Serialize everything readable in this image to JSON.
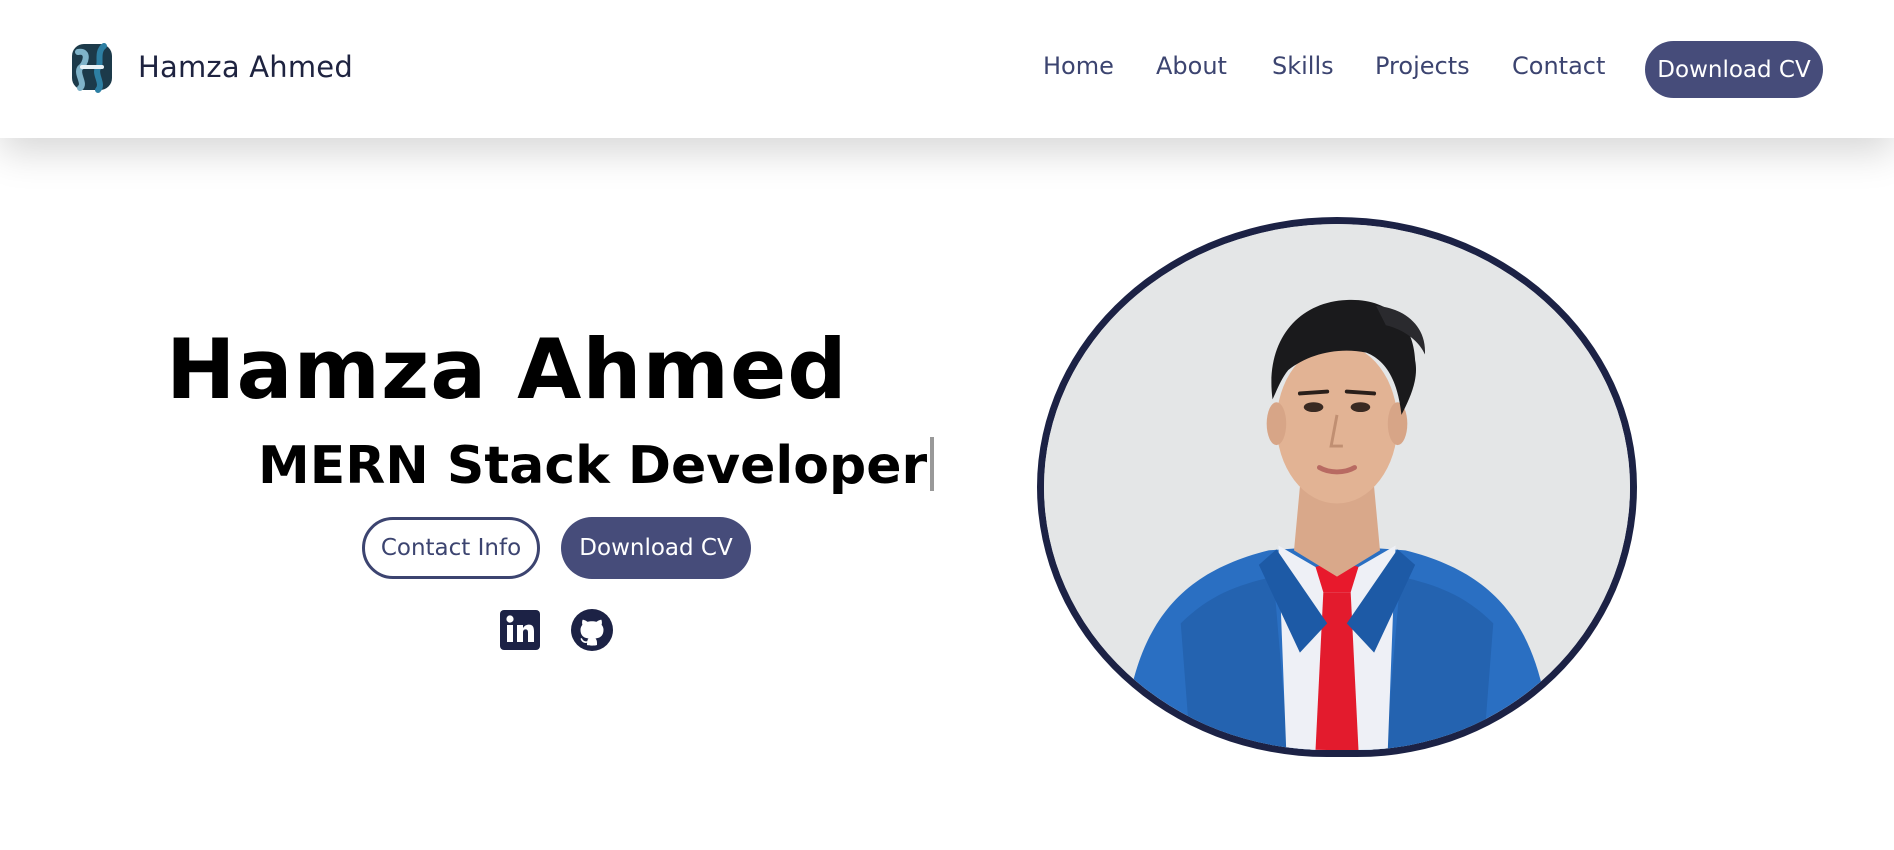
{
  "header": {
    "brand_name": "Hamza Ahmed",
    "logo_icon": "brand-logo-icon",
    "nav": [
      {
        "label": "Home"
      },
      {
        "label": "About"
      },
      {
        "label": "Skills"
      },
      {
        "label": "Projects"
      },
      {
        "label": "Contact"
      }
    ],
    "cta_label": "Download CV"
  },
  "hero": {
    "name": "Hamza Ahmed",
    "role": "MERN Stack Developer",
    "contact_button": "Contact Info",
    "download_button": "Download CV",
    "socials": [
      {
        "icon": "linkedin-icon"
      },
      {
        "icon": "github-icon"
      }
    ],
    "photo": "profile-photo"
  },
  "colors": {
    "primary": "#464c7a",
    "dark_navy": "#1c2245",
    "nav_text": "#3c4470",
    "background": "#ffffff",
    "photo_bg": "#e4e6e7"
  }
}
